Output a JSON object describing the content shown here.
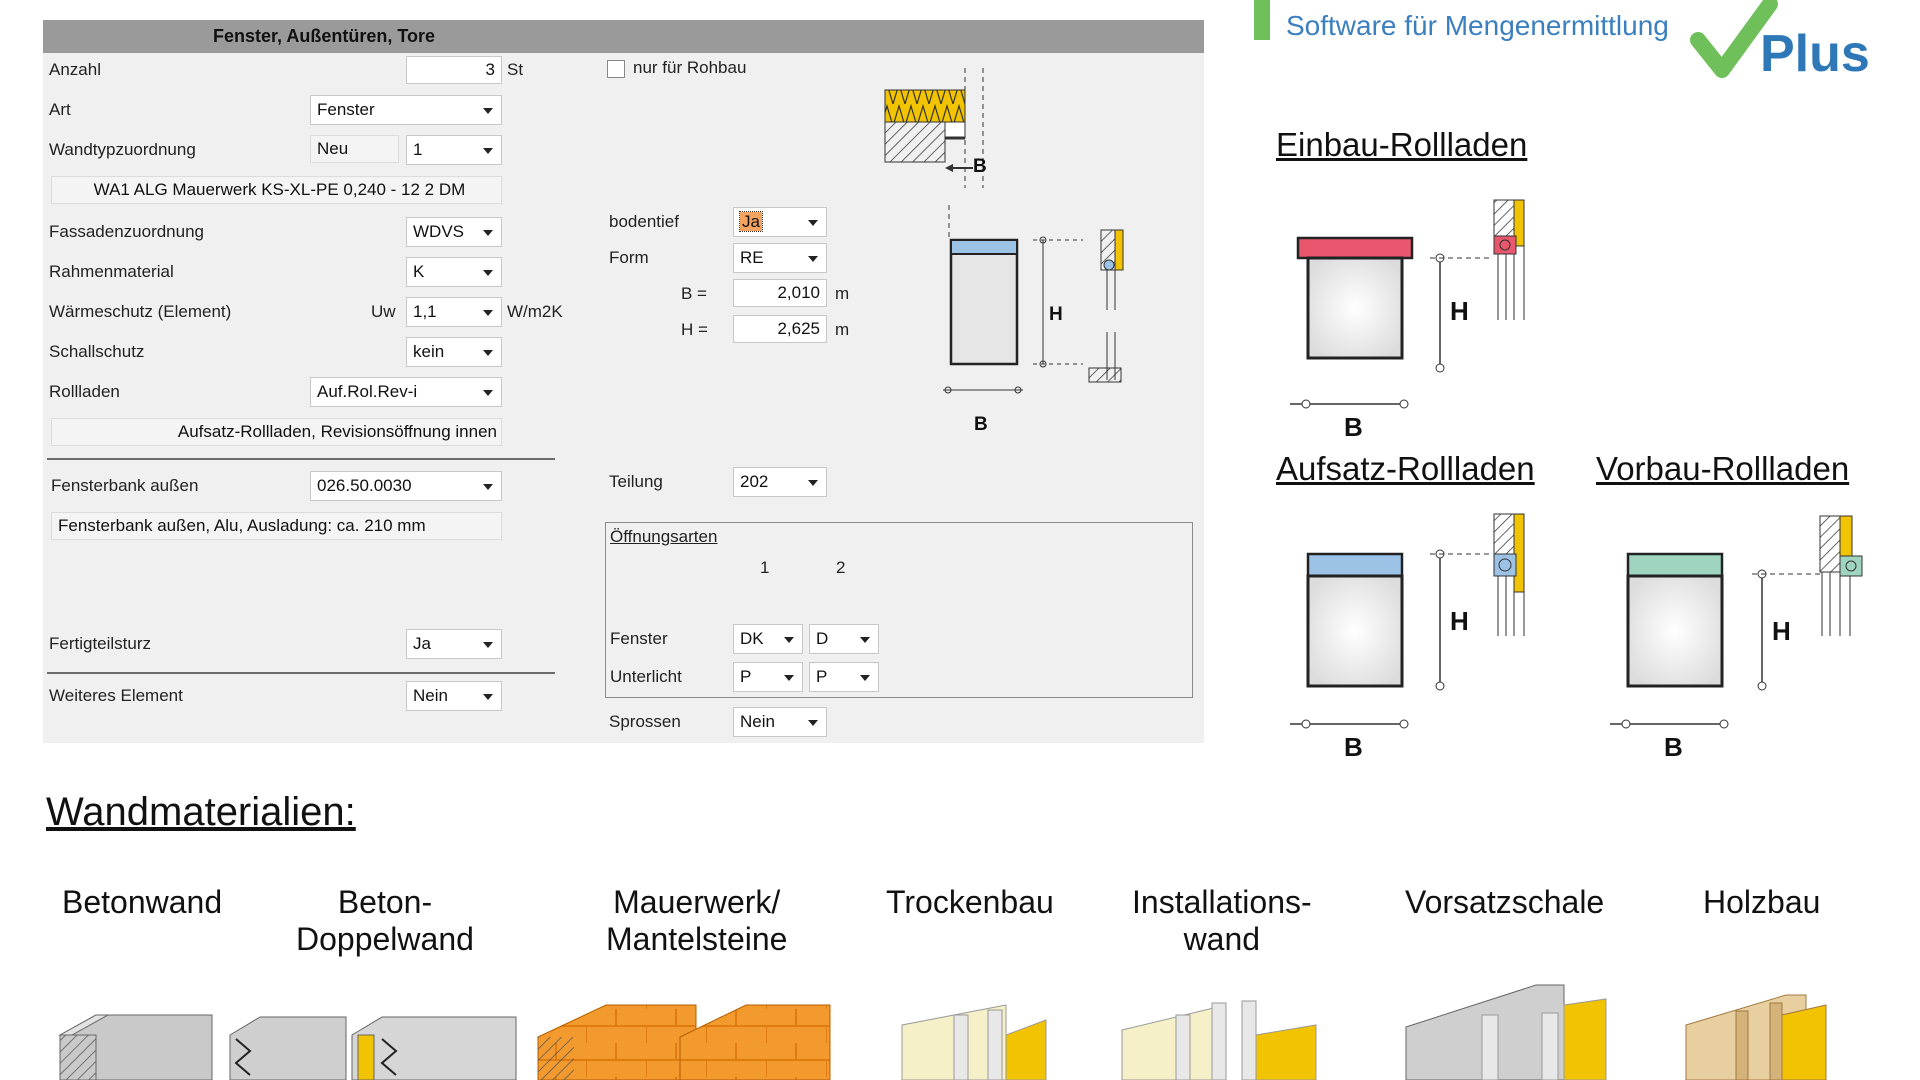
{
  "dialog": {
    "title": "Fenster, Außentüren, Tore",
    "anzahl": {
      "label": "Anzahl",
      "value": "3",
      "unit": "St"
    },
    "nur_rohbau": {
      "label": "nur für Rohbau",
      "checked": false
    },
    "art": {
      "label": "Art",
      "value": "Fenster"
    },
    "wandtyp": {
      "label": "Wandtypzuordnung",
      "status": "Neu",
      "value": "1"
    },
    "wandtyp_desc": "WA1 ALG Mauerwerk KS-XL-PE 0,240 - 12 2 DM",
    "fassade": {
      "label": "Fassadenzuordnung",
      "value": "WDVS"
    },
    "rahmen": {
      "label": "Rahmenmaterial",
      "value": "K"
    },
    "waerme": {
      "label": "Wärmeschutz (Element)",
      "prefix": "Uw",
      "value": "1,1",
      "unit": "W/m2K"
    },
    "schall": {
      "label": "Schallschutz",
      "value": "kein"
    },
    "rollladen": {
      "label": "Rollladen",
      "value": "Auf.Rol.Rev-i"
    },
    "rollladen_desc": "Aufsatz-Rollladen, Revisionsöffnung innen",
    "fensterbank": {
      "label": "Fensterbank außen",
      "value": "026.50.0030"
    },
    "fensterbank_desc": "Fensterbank außen, Alu, Ausladung: ca. 210 mm",
    "sturz": {
      "label": "Fertigteilsturz",
      "value": "Ja"
    },
    "weiteres": {
      "label": "Weiteres Element",
      "value": "Nein"
    },
    "bodentief": {
      "label": "bodentief",
      "value": "Ja"
    },
    "form": {
      "label": "Form",
      "value": "RE"
    },
    "b": {
      "label": "B =",
      "value": "2,010",
      "unit": "m"
    },
    "h": {
      "label": "H =",
      "value": "2,625",
      "unit": "m"
    },
    "teilung": {
      "label": "Teilung",
      "value": "202"
    },
    "oeffnung": {
      "title": "Öffnungsarten",
      "col1": "1",
      "col2": "2",
      "fenster_label": "Fenster",
      "fenster_1": "DK",
      "fenster_2": "D",
      "unterlicht_label": "Unterlicht",
      "unterlicht_1": "P",
      "unterlicht_2": "P"
    },
    "sprossen": {
      "label": "Sprossen",
      "value": "Nein"
    },
    "diagram": {
      "b": "B",
      "h": "H"
    }
  },
  "logo": {
    "tagline": "Software für Mengenermittlung",
    "plus": "Plus"
  },
  "rollladen_types": {
    "einbau": "Einbau-Rollladen",
    "aufsatz": "Aufsatz-Rollladen",
    "vorbau": "Vorbau-Rollladen",
    "b": "B",
    "h": "H"
  },
  "wandmaterialien": {
    "title": "Wandmaterialien:",
    "items": [
      "Betonwand",
      "Beton-\nDoppelwand",
      "Mauerwerk/\nMantelsteine",
      "Trockenbau",
      "Installations-\nwand",
      "Vorsatzschale",
      "Holzbau"
    ]
  },
  "colors": {
    "einbau_box": "#e8576e",
    "aufsatz_box": "#9cc3e6",
    "vorbau_box": "#9fd4be",
    "insulation": "#f2c300",
    "brick": "#f39a2e"
  }
}
